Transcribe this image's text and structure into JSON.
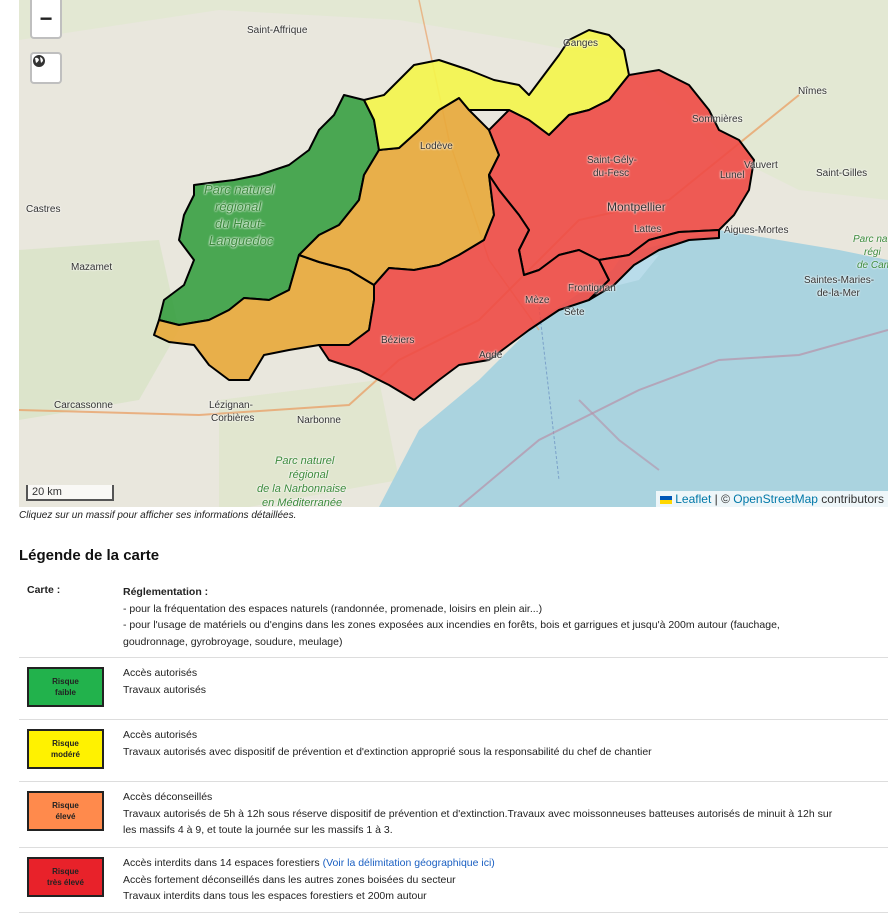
{
  "map": {
    "zoom_out_label": "−",
    "layers_icon": "globe-icon",
    "scale_label": "20 km",
    "attribution": {
      "leaflet": "Leaflet",
      "separator": " | © ",
      "osm": "OpenStreetMap",
      "suffix": " contributors"
    },
    "places": {
      "saint_affrique": "Saint-Affrique",
      "ganges": "Ganges",
      "nimes": "Nîmes",
      "sommieres": "Sommières",
      "lodeve": "Lodève",
      "saint_gely": "Saint-Gély-",
      "saint_gely_2": "du-Fesc",
      "vauvert": "Vauvert",
      "lunel": "Lunel",
      "saint_gilles": "Saint-Gilles",
      "castres": "Castres",
      "montpellier": "Montpellier",
      "lattes": "Lattes",
      "aigues_mortes": "Aigues-Mortes",
      "mazamet": "Mazamet",
      "frontignan": "Frontignan",
      "meze": "Mèze",
      "sete": "Sète",
      "beziers": "Béziers",
      "agde": "Agde",
      "carcassonne": "Carcassonne",
      "lezignan": "Lézignan-",
      "lezignan_2": "Corbières",
      "narbonne": "Narbonne",
      "saintes_maries": "Saintes-Maries-",
      "saintes_maries_2": "de-la-Mer",
      "pnr_hl_1": "Parc naturel",
      "pnr_hl_2": "régional",
      "pnr_hl_3": "du Haut-",
      "pnr_hl_4": "Languedoc",
      "pnr_nm_1": "Parc naturel",
      "pnr_nm_2": "régional",
      "pnr_nm_3": "de la Narbonnaise",
      "pnr_nm_4": "en Méditerranée",
      "pnr_c_1": "Parc na",
      "pnr_c_2": "régi",
      "pnr_c_3": "de Cam"
    },
    "colors": {
      "green": "#2e9b3a",
      "yellow": "#f4f54a",
      "orange": "#e8a93a",
      "red": "#ee4a45",
      "sea": "#aad3df"
    }
  },
  "caption": "Cliquez sur un massif pour afficher ses informations détaillées.",
  "legend": {
    "title": "Légende de la carte",
    "header": {
      "col1": "Carte :",
      "reg_title": "Réglementation :",
      "line1": "- pour la fréquentation des espaces naturels (randonnée, promenade, loisirs en plein air...)",
      "line2": "- pour l'usage de matériels ou d'engins dans les zones exposées aux incendies en forêts, bois et garrigues et jusqu'à 200m autour (fauchage,",
      "line3": "goudronnage, gyrobroyage, soudure, meulage)"
    },
    "rows": [
      {
        "badge_1": "Risque",
        "badge_2": "faible",
        "color": "#22b24c",
        "l1": "Accès autorisés",
        "l2": "Travaux autorisés"
      },
      {
        "badge_1": "Risque",
        "badge_2": "modéré",
        "color": "#fff200",
        "l1": "Accès autorisés",
        "l2": "Travaux autorisés avec dispositif de prévention et d'extinction approprié sous la responsabilité du chef de chantier"
      },
      {
        "badge_1": "Risque",
        "badge_2": "élevé",
        "color": "#ff8a4c",
        "l1": "Accès déconseillés",
        "l2": "Travaux autorisés de 5h à 12h sous réserve dispositif de prévention et d'extinction.Travaux avec moissonneuses batteuses autorisés de minuit à 12h sur",
        "l3": "les massifs 4 à 9, et toute la journée sur les massifs 1 à 3."
      },
      {
        "badge_1": "Risque",
        "badge_2": "très élevé",
        "color": "#e8222a",
        "l1": "Accès interdits dans 14 espaces forestiers ",
        "link": "(Voir la délimitation géographique ici)",
        "l2": "Accès fortement déconseillés dans les autres zones boisées du secteur",
        "l3": "Travaux interdits dans tous les espaces forestiers et 200m autour"
      }
    ]
  }
}
